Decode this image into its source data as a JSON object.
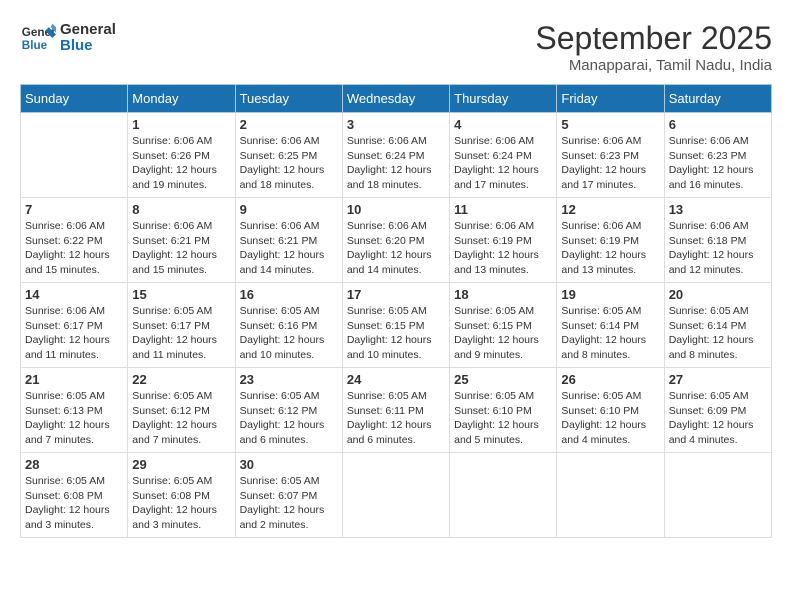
{
  "header": {
    "logo_line1": "General",
    "logo_line2": "Blue",
    "month": "September 2025",
    "location": "Manapparai, Tamil Nadu, India"
  },
  "weekdays": [
    "Sunday",
    "Monday",
    "Tuesday",
    "Wednesday",
    "Thursday",
    "Friday",
    "Saturday"
  ],
  "weeks": [
    [
      {
        "day": "",
        "detail": ""
      },
      {
        "day": "1",
        "detail": "Sunrise: 6:06 AM\nSunset: 6:26 PM\nDaylight: 12 hours\nand 19 minutes."
      },
      {
        "day": "2",
        "detail": "Sunrise: 6:06 AM\nSunset: 6:25 PM\nDaylight: 12 hours\nand 18 minutes."
      },
      {
        "day": "3",
        "detail": "Sunrise: 6:06 AM\nSunset: 6:24 PM\nDaylight: 12 hours\nand 18 minutes."
      },
      {
        "day": "4",
        "detail": "Sunrise: 6:06 AM\nSunset: 6:24 PM\nDaylight: 12 hours\nand 17 minutes."
      },
      {
        "day": "5",
        "detail": "Sunrise: 6:06 AM\nSunset: 6:23 PM\nDaylight: 12 hours\nand 17 minutes."
      },
      {
        "day": "6",
        "detail": "Sunrise: 6:06 AM\nSunset: 6:23 PM\nDaylight: 12 hours\nand 16 minutes."
      }
    ],
    [
      {
        "day": "7",
        "detail": "Sunrise: 6:06 AM\nSunset: 6:22 PM\nDaylight: 12 hours\nand 15 minutes."
      },
      {
        "day": "8",
        "detail": "Sunrise: 6:06 AM\nSunset: 6:21 PM\nDaylight: 12 hours\nand 15 minutes."
      },
      {
        "day": "9",
        "detail": "Sunrise: 6:06 AM\nSunset: 6:21 PM\nDaylight: 12 hours\nand 14 minutes."
      },
      {
        "day": "10",
        "detail": "Sunrise: 6:06 AM\nSunset: 6:20 PM\nDaylight: 12 hours\nand 14 minutes."
      },
      {
        "day": "11",
        "detail": "Sunrise: 6:06 AM\nSunset: 6:19 PM\nDaylight: 12 hours\nand 13 minutes."
      },
      {
        "day": "12",
        "detail": "Sunrise: 6:06 AM\nSunset: 6:19 PM\nDaylight: 12 hours\nand 13 minutes."
      },
      {
        "day": "13",
        "detail": "Sunrise: 6:06 AM\nSunset: 6:18 PM\nDaylight: 12 hours\nand 12 minutes."
      }
    ],
    [
      {
        "day": "14",
        "detail": "Sunrise: 6:06 AM\nSunset: 6:17 PM\nDaylight: 12 hours\nand 11 minutes."
      },
      {
        "day": "15",
        "detail": "Sunrise: 6:05 AM\nSunset: 6:17 PM\nDaylight: 12 hours\nand 11 minutes."
      },
      {
        "day": "16",
        "detail": "Sunrise: 6:05 AM\nSunset: 6:16 PM\nDaylight: 12 hours\nand 10 minutes."
      },
      {
        "day": "17",
        "detail": "Sunrise: 6:05 AM\nSunset: 6:15 PM\nDaylight: 12 hours\nand 10 minutes."
      },
      {
        "day": "18",
        "detail": "Sunrise: 6:05 AM\nSunset: 6:15 PM\nDaylight: 12 hours\nand 9 minutes."
      },
      {
        "day": "19",
        "detail": "Sunrise: 6:05 AM\nSunset: 6:14 PM\nDaylight: 12 hours\nand 8 minutes."
      },
      {
        "day": "20",
        "detail": "Sunrise: 6:05 AM\nSunset: 6:14 PM\nDaylight: 12 hours\nand 8 minutes."
      }
    ],
    [
      {
        "day": "21",
        "detail": "Sunrise: 6:05 AM\nSunset: 6:13 PM\nDaylight: 12 hours\nand 7 minutes."
      },
      {
        "day": "22",
        "detail": "Sunrise: 6:05 AM\nSunset: 6:12 PM\nDaylight: 12 hours\nand 7 minutes."
      },
      {
        "day": "23",
        "detail": "Sunrise: 6:05 AM\nSunset: 6:12 PM\nDaylight: 12 hours\nand 6 minutes."
      },
      {
        "day": "24",
        "detail": "Sunrise: 6:05 AM\nSunset: 6:11 PM\nDaylight: 12 hours\nand 6 minutes."
      },
      {
        "day": "25",
        "detail": "Sunrise: 6:05 AM\nSunset: 6:10 PM\nDaylight: 12 hours\nand 5 minutes."
      },
      {
        "day": "26",
        "detail": "Sunrise: 6:05 AM\nSunset: 6:10 PM\nDaylight: 12 hours\nand 4 minutes."
      },
      {
        "day": "27",
        "detail": "Sunrise: 6:05 AM\nSunset: 6:09 PM\nDaylight: 12 hours\nand 4 minutes."
      }
    ],
    [
      {
        "day": "28",
        "detail": "Sunrise: 6:05 AM\nSunset: 6:08 PM\nDaylight: 12 hours\nand 3 minutes."
      },
      {
        "day": "29",
        "detail": "Sunrise: 6:05 AM\nSunset: 6:08 PM\nDaylight: 12 hours\nand 3 minutes."
      },
      {
        "day": "30",
        "detail": "Sunrise: 6:05 AM\nSunset: 6:07 PM\nDaylight: 12 hours\nand 2 minutes."
      },
      {
        "day": "",
        "detail": ""
      },
      {
        "day": "",
        "detail": ""
      },
      {
        "day": "",
        "detail": ""
      },
      {
        "day": "",
        "detail": ""
      }
    ]
  ]
}
